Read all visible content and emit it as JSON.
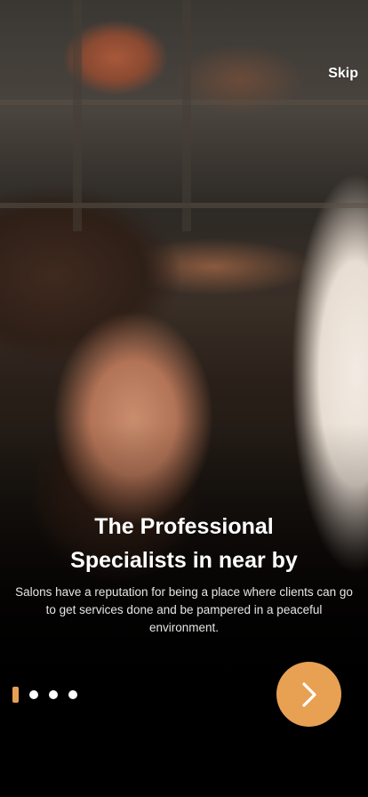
{
  "onboarding": {
    "skip_label": "Skip",
    "title_line1": "The Professional",
    "title_line2": "Specialists in near by",
    "description": "Salons have a reputation for being a place where clients can go to get services done and be pampered in a peaceful environment.",
    "page_indicator": {
      "total": 4,
      "active_index": 0
    },
    "next_icon": "chevron-right-icon",
    "background_image": "barber-trimming-beard-photo"
  },
  "colors": {
    "accent": "#E8A053",
    "indicator_active": "#E8A053",
    "indicator_inactive": "#FFFFFF",
    "text_primary": "#FFFFFF"
  }
}
